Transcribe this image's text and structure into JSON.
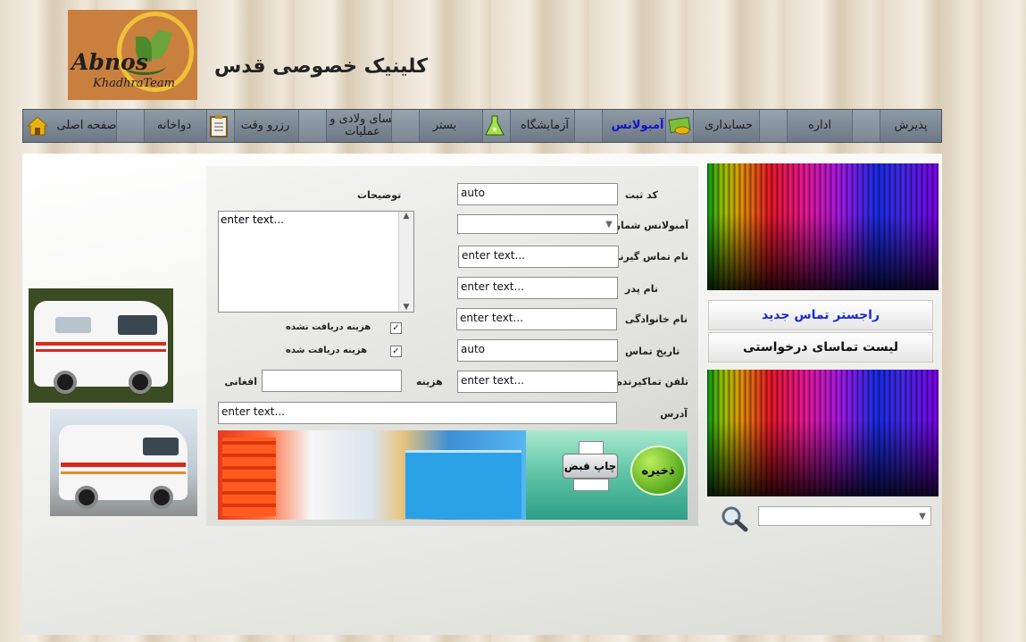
{
  "header": {
    "logo_text_1": "Abnos",
    "logo_text_2": "KhadhraTeam",
    "clinic_title": "کلینیک خصوصی قدس"
  },
  "nav": {
    "items": [
      {
        "label": "پذیرش"
      },
      {
        "label": "اداره"
      },
      {
        "label": "حسابداری"
      },
      {
        "label": "آمبولانس",
        "active": true
      },
      {
        "label": "آزمایشگاه"
      },
      {
        "label": "بستر"
      },
      {
        "label": "نسای ولادی و عملیات"
      },
      {
        "label": "رزرو وقت"
      },
      {
        "label": "دواخانه"
      },
      {
        "label": "صفحه اصلی"
      }
    ],
    "icons": [
      "money-icon",
      "lab-flask-icon",
      "clipboard-icon",
      "home-icon"
    ]
  },
  "form": {
    "registration_code_label": "کد ثبت",
    "registration_code_value": "auto",
    "ambulance_number_label": "آمبولانس شماره",
    "ambulance_number_value": "",
    "caller_name_label": "نام تماس گیرنده",
    "caller_name_value": "enter text...",
    "father_name_label": "نام پدر",
    "father_name_value": "enter text...",
    "family_name_label": "نام خانوادگی",
    "family_name_value": "enter text...",
    "contact_date_label": "تاریخ تماس",
    "contact_date_value": "auto",
    "caller_phone_label": "تلفن تماکیرنده",
    "caller_phone_value": "enter text...",
    "address_label": "آدرس",
    "address_value": "enter text...",
    "description_label": "توضیحات",
    "description_value": "enter text...",
    "fee_not_received_label": "هزینه دریافت نشده",
    "fee_received_label": "هزینه دریافت شده",
    "cost_label": "هزینه",
    "cost_value": "",
    "currency_label": "افغانی",
    "fee_not_received_checked": "✓",
    "fee_received_checked": "✓"
  },
  "actions": {
    "save_label": "ذخیره",
    "print_label": "چاپ قبض"
  },
  "side": {
    "new_contact_register": "راجستر تماس جدید",
    "requested_contacts_list": "لیست تماسای درخواستی",
    "search_select_value": ""
  },
  "colors": {
    "nav_active": "#1414c8",
    "new_contact_text": "#1a2ad6",
    "save_green": "#5aa91f"
  }
}
